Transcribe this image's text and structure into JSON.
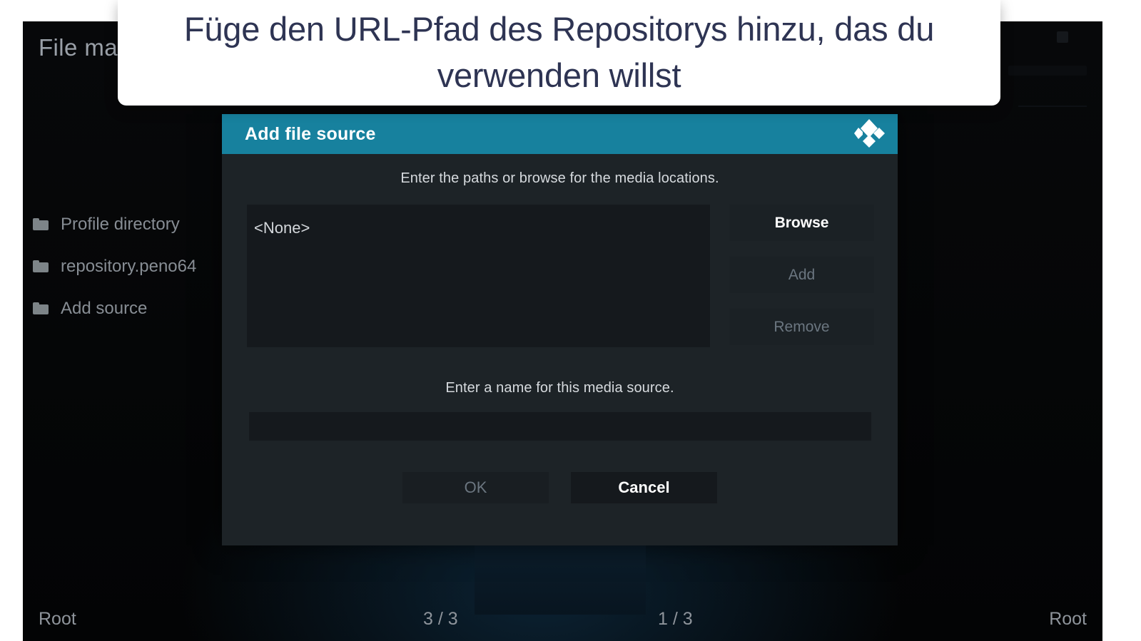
{
  "overlay": {
    "text": "Füge den URL-Pfad des Repositorys hinzu, das du verwenden willst"
  },
  "app": {
    "title": "File ma",
    "title_full": "File manager"
  },
  "sidebar": {
    "items": [
      {
        "label": "Profile directory",
        "icon": "folder-icon"
      },
      {
        "label": "repository.peno64",
        "icon": "folder-icon"
      },
      {
        "label": "Add source",
        "icon": "folder-icon"
      }
    ]
  },
  "status_bar": {
    "left_label": "Root",
    "left_count": "3 / 3",
    "right_count": "1 / 3",
    "right_label": "Root"
  },
  "dialog": {
    "title": "Add file source",
    "logo_icon": "kodi-logo-icon",
    "paths_hint": "Enter the paths or browse for the media locations.",
    "paths_list": [
      "<None>"
    ],
    "buttons": [
      {
        "label": "Browse",
        "enabled": true
      },
      {
        "label": "Add",
        "enabled": false
      },
      {
        "label": "Remove",
        "enabled": false
      }
    ],
    "name_hint": "Enter a name for this media source.",
    "name_value": "",
    "name_placeholder": "",
    "footer": [
      {
        "label": "OK",
        "enabled": false
      },
      {
        "label": "Cancel",
        "enabled": true
      }
    ]
  },
  "colors": {
    "dialog_header": "#17819e",
    "dialog_body": "#1d2327",
    "overlay_text": "#2e3453",
    "app_background": "#050607",
    "disabled_text": "#6b7680"
  }
}
